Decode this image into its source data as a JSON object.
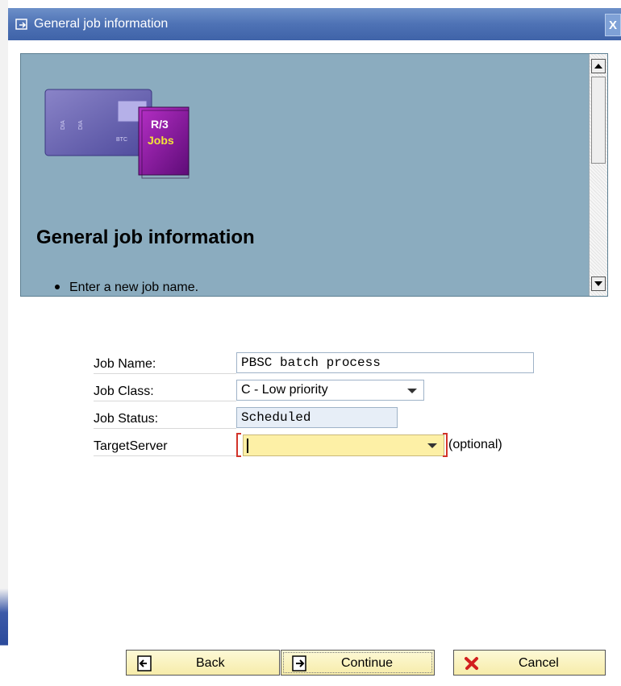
{
  "window": {
    "title": "General job information",
    "close_glyph": "X",
    "accent_color": "#4e72b5"
  },
  "banner": {
    "logo_top_text": "R/3",
    "logo_bottom_text": "Jobs",
    "logo_card_text_1": "DIA",
    "logo_card_text_2": "DIA",
    "logo_card_text_3": "BTC",
    "heading": "General job information",
    "bullets": [
      "Enter a new job name."
    ],
    "background_color": "#8bacbf"
  },
  "form": {
    "job_name": {
      "label": "Job Name:",
      "value": "PBSC batch process"
    },
    "job_class": {
      "label": "Job Class:",
      "value": "C - Low priority"
    },
    "job_status": {
      "label": "Job Status:",
      "value": "Scheduled"
    },
    "target_server": {
      "label": "TargetServer",
      "value": "",
      "hint": "(optional)"
    }
  },
  "buttons": {
    "back": {
      "label": "Back",
      "icon": "back-arrow-icon"
    },
    "continue": {
      "label": "Continue",
      "icon": "forward-arrow-icon"
    },
    "cancel": {
      "label": "Cancel",
      "icon": "red-x-icon"
    }
  }
}
